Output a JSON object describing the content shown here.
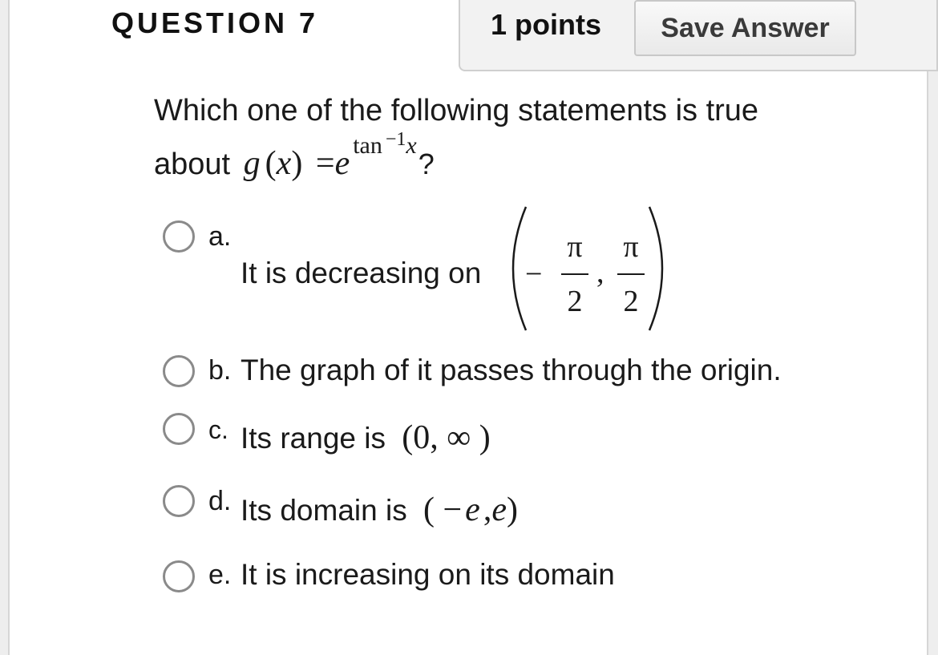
{
  "question": {
    "title": "QUESTION 7",
    "points_label": "1 points",
    "save_label": "Save Answer",
    "prompt_line1": "Which one of the following statements is true",
    "prompt_about": "about",
    "prompt_func": "g",
    "prompt_lparen": "(",
    "prompt_var": "x",
    "prompt_rparen": ")",
    "prompt_eq": "=",
    "prompt_e": "e",
    "prompt_exp": "tan",
    "prompt_exp_sup": "−1",
    "prompt_exp_var": "x",
    "prompt_qmark": "?"
  },
  "options": [
    {
      "letter": "a.",
      "text": "It is decreasing on",
      "minus": "−",
      "pi1": "π",
      "den1": "2",
      "comma": ",",
      "pi2": "π",
      "den2": "2"
    },
    {
      "letter": "b.",
      "text": "The graph of it passes through the origin."
    },
    {
      "letter": "c.",
      "text": "Its range is",
      "math": "(0, ∞ )"
    },
    {
      "letter": "d.",
      "text": "Its domain is",
      "math_open": "( −",
      "math_e1": "e",
      "math_comma": ",",
      "math_e2": "e",
      "math_close": ")"
    },
    {
      "letter": "e.",
      "text": "It is increasing on its domain"
    }
  ]
}
